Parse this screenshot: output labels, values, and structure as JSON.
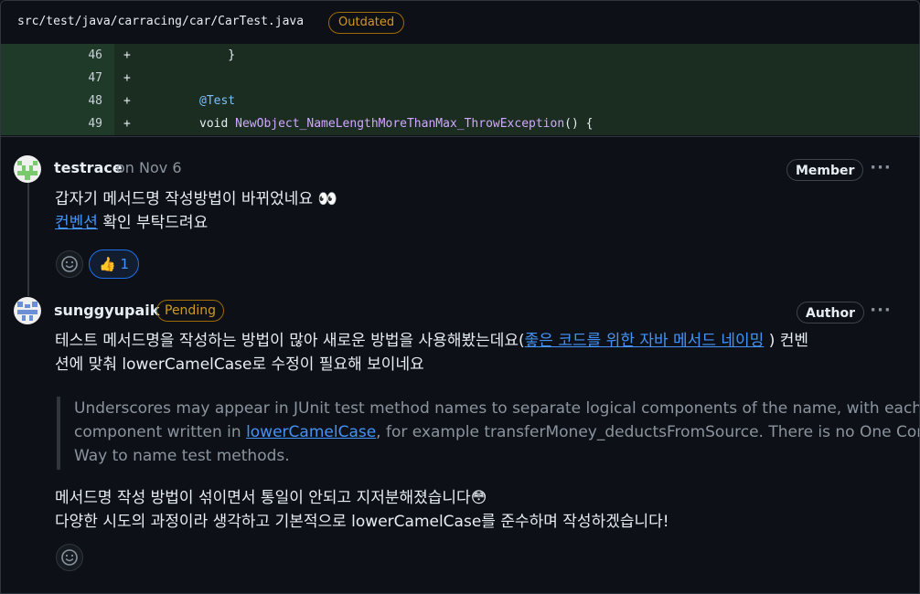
{
  "file": {
    "path": "src/test/java/carracing/car/CarTest.java",
    "badge": "Outdated"
  },
  "code_lines": [
    {
      "num": "46",
      "sign": "+",
      "text": "    }"
    },
    {
      "num": "47",
      "sign": "+",
      "text": ""
    },
    {
      "num": "48",
      "sign": "+",
      "annotation": "@Test"
    },
    {
      "num": "49",
      "sign": "+",
      "kw": "void ",
      "fn": "NewObject_NameLengthMoreThanMax_ThrowException",
      "tail": "() {"
    }
  ],
  "comments": [
    {
      "author": "testrace",
      "date": "on Nov 6",
      "role": "Member",
      "more": "···",
      "line1": "갑자기 메서드명 작성방법이 바뀌었네요 👀",
      "line2_link": "컨벤션",
      "line2_rest": " 확인 부탁드려요",
      "reaction_emoji": "👍",
      "reaction_count": "1"
    },
    {
      "author": "sunggyupaik",
      "badge": "Pending",
      "role": "Author",
      "more": "···",
      "p1_line1_start": "테스트 메서드명을 작성하는 방법이 많아 새로운 방법을 사용해봤는데요(",
      "p1_link": "좋은 코드를 위한 자바 메서드 네이밍",
      "p1_line1_end": " ) 컨벤",
      "p1_line2": "션에 맞춰 lowerCamelCase로 수정이 필요해 보이네요",
      "quote_line1": "Underscores may appear in JUnit test method names to separate logical components of the name, with each",
      "quote_line2_start": "component written in ",
      "quote_link": "lowerCamelCase",
      "quote_line2_end": ", for example transferMoney_deductsFromSource. There is no One Correct",
      "quote_line3": "Way to name test methods.",
      "p2_line1": "메서드명 작성 방법이 섞이면서 통일이 안되고 지저분해졌습니다😳",
      "p2_line2": "다양한 시도의 과정이라 생각하고 기본적으로 lowerCamelCase를 준수하며 작성하겠습니다!"
    }
  ],
  "colors": {
    "background": "#0d1117",
    "added_line": "#1b2d21",
    "link": "#4493f8",
    "warning": "#d29922"
  }
}
